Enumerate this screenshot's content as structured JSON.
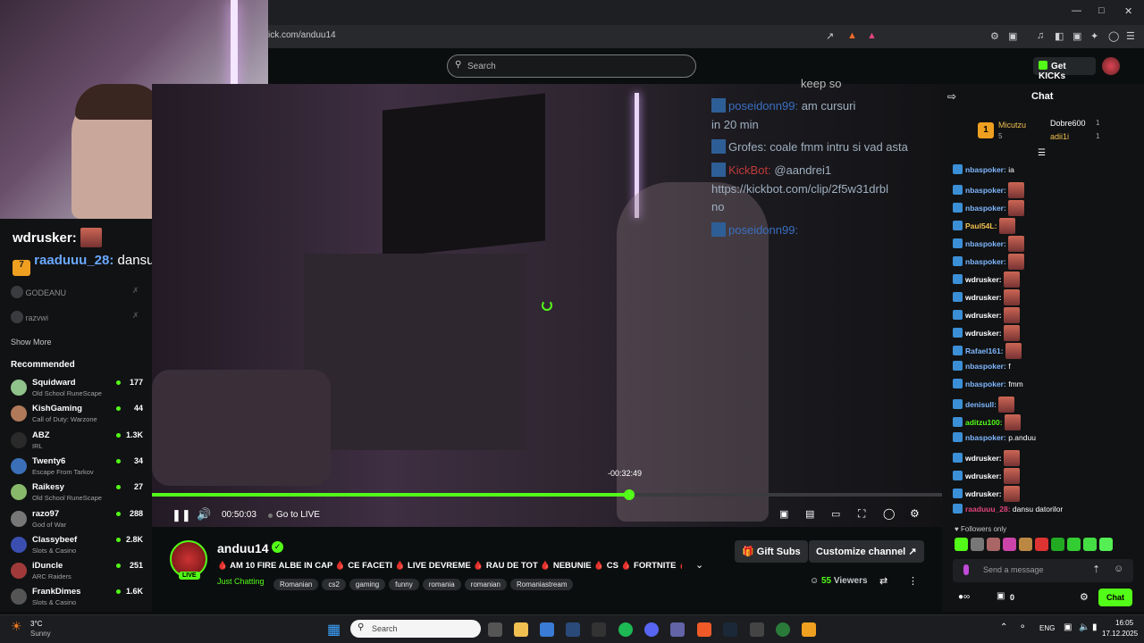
{
  "browser": {
    "url": "ick.com/anduu14",
    "window_controls": [
      "minimize-icon",
      "maximize-icon",
      "close-icon"
    ]
  },
  "header": {
    "search_placeholder": "Search",
    "get_kicks_label": "Get KICKs"
  },
  "webcam_overlay": {
    "chat_line1_user": "wdrusker:",
    "chat_line2_user": "raaduuu_28:",
    "chat_line2_text": "dansu datorilor"
  },
  "sidebar": {
    "followed": [
      {
        "name": "GODEANU"
      },
      {
        "name": "razvwi"
      }
    ],
    "show_more": "Show More",
    "recommended_title": "Recommended",
    "recommended": [
      {
        "name": "Squidward",
        "game": "Old School RuneScape",
        "viewers": "177",
        "avatar_color": "#8fc38b"
      },
      {
        "name": "KishGaming",
        "game": "Call of Duty: Warzone",
        "viewers": "44",
        "avatar_color": "#b07a5a"
      },
      {
        "name": "ABZ",
        "game": "IRL",
        "viewers": "1.3K",
        "avatar_color": "#2a2a2a"
      },
      {
        "name": "Twenty6",
        "game": "Escape From Tarkov",
        "viewers": "34",
        "avatar_color": "#3b6fb8"
      },
      {
        "name": "Raikesy",
        "game": "Old School RuneScape",
        "viewers": "27",
        "avatar_color": "#88b86a"
      },
      {
        "name": "razo97",
        "game": "God of War",
        "viewers": "288",
        "avatar_color": "#777777"
      },
      {
        "name": "Classybeef",
        "game": "Slots & Casino",
        "viewers": "2.8K",
        "avatar_color": "#3a4fb0"
      },
      {
        "name": "iDuncle",
        "game": "ARC Raiders",
        "viewers": "251",
        "avatar_color": "#a03a3a"
      },
      {
        "name": "FrankDimes",
        "game": "Slots & Casino",
        "viewers": "1.6K",
        "avatar_color": "#555555"
      }
    ]
  },
  "video": {
    "overlay_chat": [
      {
        "user": "poseidonn99:",
        "text": "am cursuri",
        "user_color": "#3a6fc0"
      },
      {
        "user": "",
        "text": "in 20 min",
        "user_color": "#9fb0c0"
      },
      {
        "user": "Grofes:",
        "text": "coale fmm intru si vad asta",
        "user_color": "#9fb0c0"
      },
      {
        "user": "KickBot:",
        "text": "@aandrei1",
        "user_color": "#c03a3a"
      },
      {
        "user": "",
        "text": "https://kickbot.com/clip/2f5w31drbl",
        "user_color": "#9fb0c0"
      },
      {
        "user": "",
        "text": "no",
        "user_color": "#9fb0c0"
      },
      {
        "user": "poseidonn99:",
        "text": "",
        "user_color": "#3a6fc0"
      }
    ],
    "top_partial": "keep so",
    "seek_tooltip": "-00:32:49",
    "elapsed": "00:50:03",
    "go_live": "Go to LIVE",
    "progress_fraction": 0.604
  },
  "stream": {
    "channel": "anduu14",
    "live_badge": "LIVE",
    "title": "🩸 AM 10 FIRE ALBE IN CAP 🩸 CE FACETI 🩸 LIVE DEVREME 🩸 RAU DE TOT 🩸 NEBUNIE 🩸 CS 🩸 FORTNITE 🩸 ...",
    "category": "Just Chatting",
    "tags": [
      "Romanian",
      "cs2",
      "gaming",
      "funny",
      "romania",
      "romanian",
      "Romaniastream"
    ],
    "gift_subs": "Gift Subs",
    "customize": "Customize channel",
    "viewers": "55",
    "viewers_label": "Viewers"
  },
  "chat": {
    "title": "Chat",
    "leaders": [
      {
        "rank": "1",
        "name": "Micutzu",
        "count": "5"
      },
      {
        "name": "Dobre600",
        "count": "1"
      },
      {
        "name": "adii1i",
        "count": "1"
      }
    ],
    "messages": [
      {
        "user": "nbaspoker:",
        "text": "ia",
        "color": "#7fb7ff",
        "emote": false
      },
      {
        "user": "nbaspoker:",
        "text": "",
        "color": "#7fb7ff",
        "emote": true
      },
      {
        "user": "nbaspoker:",
        "text": "",
        "color": "#7fb7ff",
        "emote": true
      },
      {
        "user": "Paul54L:",
        "text": "",
        "color": "#f0c050",
        "emote": true
      },
      {
        "user": "nbaspoker:",
        "text": "",
        "color": "#7fb7ff",
        "emote": true
      },
      {
        "user": "nbaspoker:",
        "text": "",
        "color": "#7fb7ff",
        "emote": true
      },
      {
        "user": "wdrusker:",
        "text": "",
        "color": "#ffffff",
        "emote": true
      },
      {
        "user": "wdrusker:",
        "text": "",
        "color": "#ffffff",
        "emote": true
      },
      {
        "user": "wdrusker:",
        "text": "",
        "color": "#ffffff",
        "emote": true
      },
      {
        "user": "wdrusker:",
        "text": "",
        "color": "#ffffff",
        "emote": true
      },
      {
        "user": "Rafael161:",
        "text": "",
        "color": "#7fb7ff",
        "emote": true
      },
      {
        "user": "nbaspoker:",
        "text": "f",
        "color": "#7fb7ff",
        "emote": false
      },
      {
        "user": "nbaspoker:",
        "text": "fmm",
        "color": "#7fb7ff",
        "emote": false
      },
      {
        "user": "denisull:",
        "text": "",
        "color": "#7fb7ff",
        "emote": true
      },
      {
        "user": "aditzu100:",
        "text": "",
        "color": "#53fc18",
        "emote": true
      },
      {
        "user": "nbaspoker:",
        "text": "p.anduu",
        "color": "#7fb7ff",
        "emote": false
      },
      {
        "user": "wdrusker:",
        "text": "",
        "color": "#ffffff",
        "emote": true
      },
      {
        "user": "wdrusker:",
        "text": "",
        "color": "#ffffff",
        "emote": true
      },
      {
        "user": "wdrusker:",
        "text": "",
        "color": "#ffffff",
        "emote": true
      },
      {
        "user": "raaduuu_28:",
        "text": "dansu datorilor",
        "color": "#e0457a",
        "emote": false
      }
    ],
    "followers_only": "Followers only",
    "input_placeholder": "Send a message",
    "kicks_count": "0",
    "send_label": "Chat"
  },
  "taskbar": {
    "weather_temp": "3°C",
    "weather_desc": "Sunny",
    "search_placeholder": "Search",
    "lang": "ENG",
    "time": "16:05",
    "date": "17.12.2025"
  }
}
